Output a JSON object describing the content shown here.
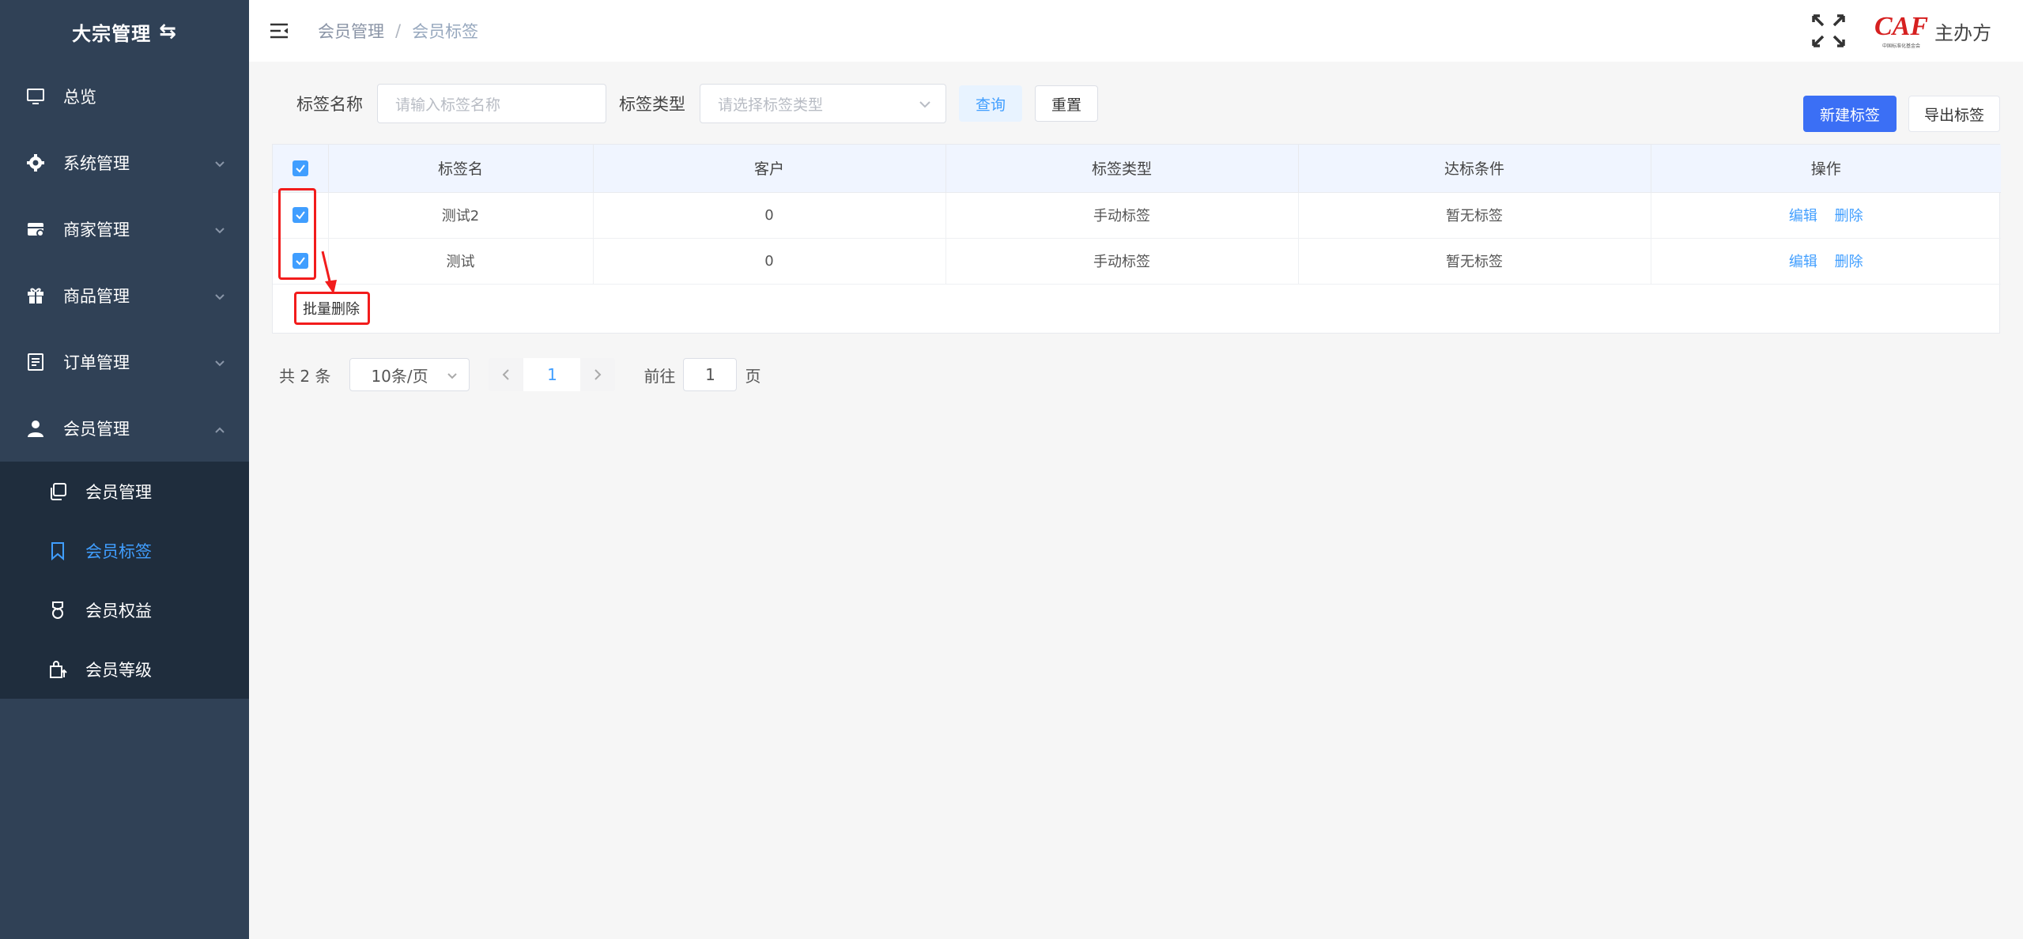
{
  "sidebar": {
    "title": "大宗管理",
    "items": [
      {
        "label": "总览",
        "icon": "monitor-icon"
      },
      {
        "label": "系统管理",
        "icon": "gear-icon"
      },
      {
        "label": "商家管理",
        "icon": "store-icon"
      },
      {
        "label": "商品管理",
        "icon": "gift-icon"
      },
      {
        "label": "订单管理",
        "icon": "document-icon"
      },
      {
        "label": "会员管理",
        "icon": "user-icon"
      }
    ],
    "submenu": [
      {
        "label": "会员管理",
        "icon": "copy-icon"
      },
      {
        "label": "会员标签",
        "icon": "bookmark-icon",
        "active": true
      },
      {
        "label": "会员权益",
        "icon": "medal-icon"
      },
      {
        "label": "会员等级",
        "icon": "bag-upgrade-icon"
      }
    ]
  },
  "header": {
    "breadcrumb": [
      "会员管理",
      "会员标签"
    ],
    "logo_text": "CAF",
    "logo_sub": "中国标准化基金会",
    "host_label": "主办方"
  },
  "search": {
    "name_label": "标签名称",
    "name_placeholder": "请输入标签名称",
    "type_label": "标签类型",
    "type_placeholder": "请选择标签类型",
    "query_btn": "查询",
    "reset_btn": "重置"
  },
  "actions": {
    "new_btn": "新建标签",
    "export_btn": "导出标签"
  },
  "table": {
    "columns": [
      "标签名",
      "客户",
      "标签类型",
      "达标条件",
      "操作"
    ],
    "rows": [
      {
        "name": "测试2",
        "customers": "0",
        "type": "手动标签",
        "condition": "暂无标签",
        "edit": "编辑",
        "delete": "删除",
        "checked": true
      },
      {
        "name": "测试",
        "customers": "0",
        "type": "手动标签",
        "condition": "暂无标签",
        "edit": "编辑",
        "delete": "删除",
        "checked": true
      }
    ],
    "batch_delete": "批量删除"
  },
  "pagination": {
    "total": "共 2 条",
    "page_size": "10条/页",
    "current_page": "1",
    "goto_prefix": "前往",
    "goto_value": "1",
    "goto_suffix": "页"
  },
  "colors": {
    "sidebar_bg": "#304156",
    "submenu_bg": "#1f2d3d",
    "primary": "#409eff",
    "new_button": "#3b6ff5",
    "annotation": "#f21c1c"
  }
}
